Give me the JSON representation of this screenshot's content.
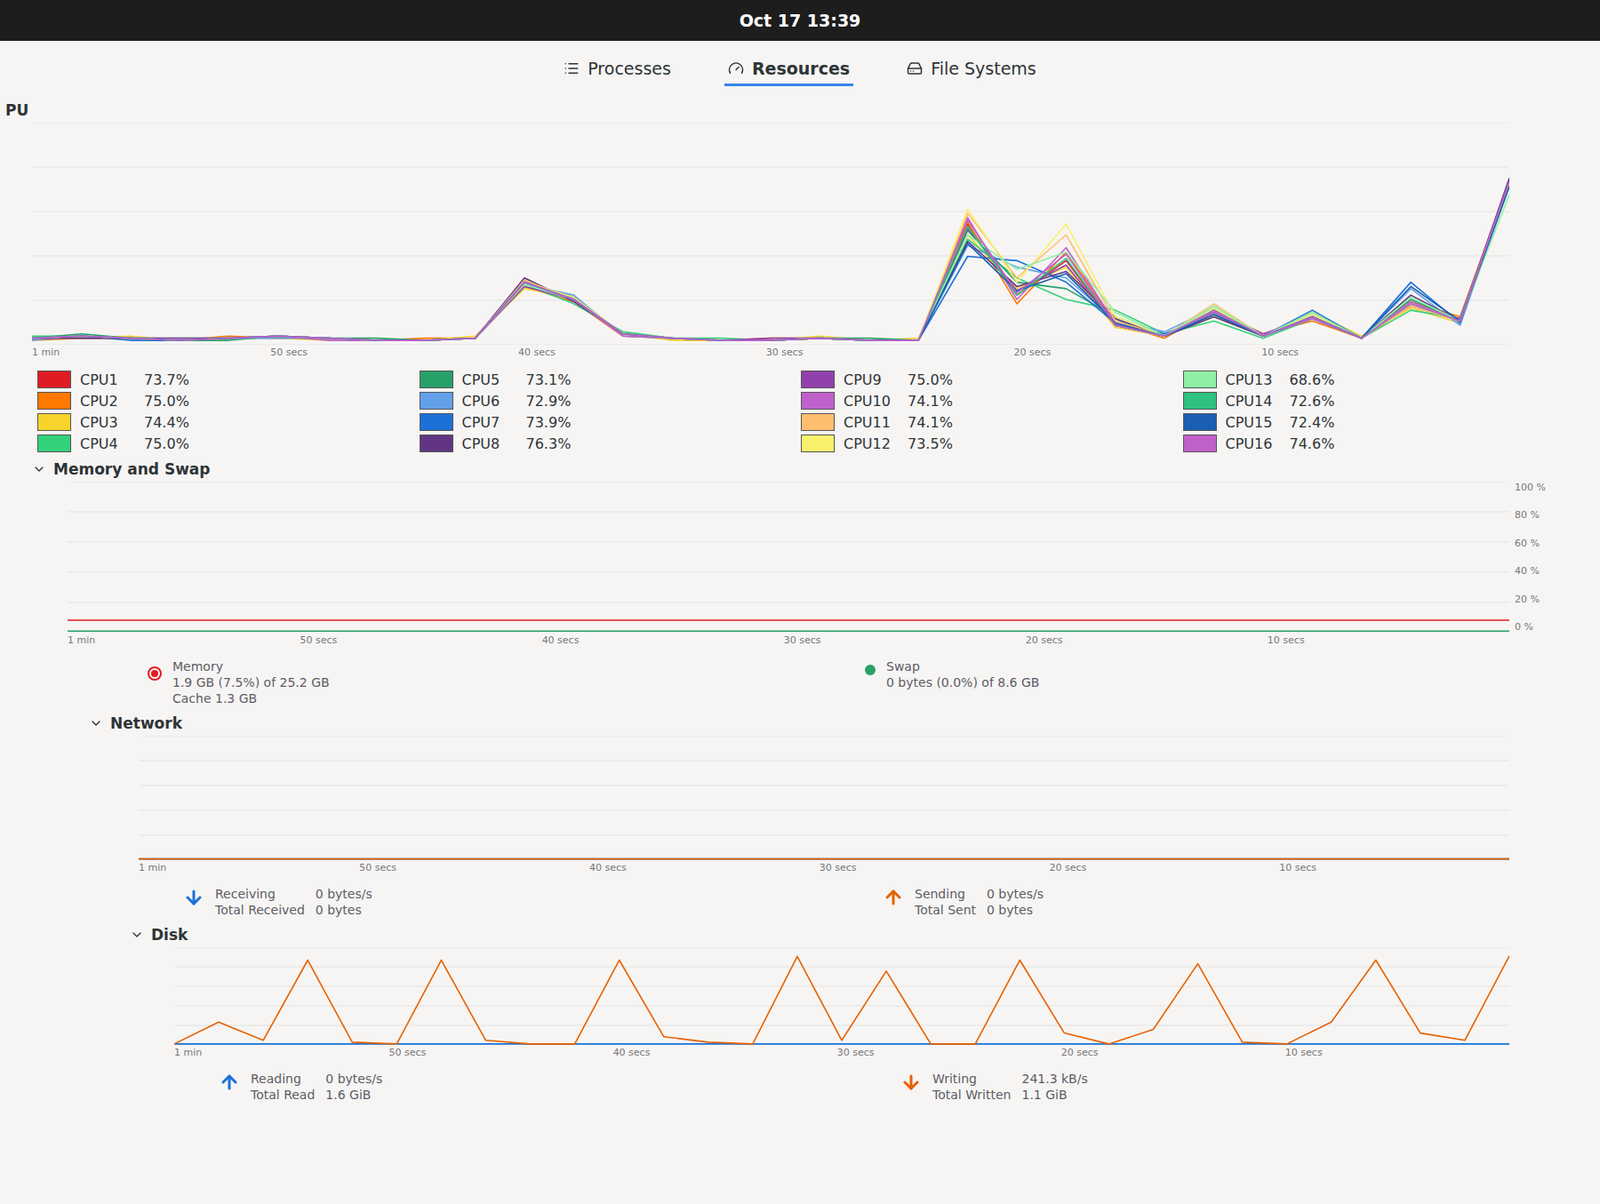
{
  "top_bar": {
    "clock": "Oct 17 13:39"
  },
  "tabs": [
    {
      "label": "Processes",
      "selected": false
    },
    {
      "label": "Resources",
      "selected": true
    },
    {
      "label": "File Systems",
      "selected": false
    }
  ],
  "cpu": {
    "title": "PU",
    "y_max": 100,
    "x_ticks": [
      "1 min",
      "50 secs",
      "40 secs",
      "30 secs",
      "20 secs",
      "10 secs"
    ],
    "series": [
      {
        "name": "CPU1",
        "reading": "73.7%",
        "color": "#e01b24",
        "values": [
          2,
          3,
          2,
          1,
          2,
          3,
          2,
          1,
          1,
          2,
          28,
          20,
          4,
          2,
          1,
          1,
          2,
          1,
          1,
          55,
          22,
          38,
          8,
          3,
          14,
          3,
          12,
          2,
          17,
          10,
          73.7
        ]
      },
      {
        "name": "CPU2",
        "reading": "75.0%",
        "color": "#ff7800",
        "values": [
          1,
          2,
          2,
          1,
          3,
          2,
          2,
          1,
          2,
          2,
          26,
          19,
          3,
          2,
          1,
          2,
          2,
          1,
          1,
          56,
          18,
          42,
          9,
          2,
          15,
          4,
          10,
          2,
          19,
          12,
          75.0
        ]
      },
      {
        "name": "CPU3",
        "reading": "74.4%",
        "color": "#f6d32d",
        "values": [
          2,
          2,
          3,
          1,
          2,
          2,
          1,
          1,
          1,
          3,
          25,
          21,
          4,
          1,
          1,
          1,
          3,
          1,
          2,
          50,
          25,
          35,
          7,
          3,
          12,
          3,
          14,
          3,
          16,
          9,
          74.4
        ]
      },
      {
        "name": "CPU4",
        "reading": "75.0%",
        "color": "#33d17a",
        "values": [
          3,
          3,
          2,
          2,
          2,
          3,
          2,
          1,
          1,
          2,
          27,
          18,
          5,
          2,
          2,
          1,
          2,
          1,
          1,
          48,
          30,
          20,
          15,
          4,
          10,
          2,
          11,
          2,
          15,
          11,
          75.0
        ]
      },
      {
        "name": "CPU5",
        "reading": "73.1%",
        "color": "#26a269",
        "values": [
          2,
          4,
          2,
          1,
          1,
          3,
          2,
          2,
          1,
          2,
          29,
          20,
          4,
          2,
          1,
          1,
          2,
          2,
          1,
          52,
          28,
          25,
          12,
          3,
          13,
          3,
          12,
          2,
          20,
          10,
          73.1
        ]
      },
      {
        "name": "CPU6",
        "reading": "72.9%",
        "color": "#62a0ea",
        "values": [
          1,
          3,
          2,
          1,
          2,
          2,
          2,
          1,
          1,
          2,
          27,
          22,
          3,
          2,
          1,
          1,
          2,
          1,
          1,
          45,
          35,
          30,
          10,
          5,
          16,
          3,
          13,
          2,
          25,
          8,
          72.9
        ]
      },
      {
        "name": "CPU7",
        "reading": "73.9%",
        "color": "#1c71d8",
        "values": [
          2,
          3,
          1,
          1,
          2,
          3,
          2,
          1,
          1,
          2,
          28,
          21,
          4,
          2,
          1,
          1,
          2,
          1,
          1,
          40,
          38,
          28,
          9,
          4,
          14,
          3,
          15,
          2,
          28,
          9,
          73.9
        ]
      },
      {
        "name": "CPU8",
        "reading": "76.3%",
        "color": "#613583",
        "values": [
          2,
          2,
          2,
          1,
          2,
          3,
          2,
          1,
          1,
          2,
          30,
          19,
          4,
          2,
          1,
          1,
          2,
          1,
          1,
          47,
          26,
          33,
          11,
          3,
          12,
          3,
          12,
          2,
          22,
          10,
          76.3
        ]
      },
      {
        "name": "CPU9",
        "reading": "75.0%",
        "color": "#9141ac",
        "values": [
          2,
          3,
          2,
          2,
          2,
          3,
          2,
          1,
          1,
          2,
          26,
          20,
          4,
          2,
          1,
          2,
          2,
          1,
          1,
          53,
          24,
          36,
          8,
          3,
          15,
          4,
          12,
          2,
          18,
          11,
          75.0
        ]
      },
      {
        "name": "CPU10",
        "reading": "74.1%",
        "color": "#c061cb",
        "values": [
          2,
          3,
          2,
          1,
          2,
          3,
          1,
          1,
          1,
          2,
          28,
          20,
          3,
          2,
          1,
          1,
          2,
          1,
          1,
          58,
          20,
          44,
          9,
          3,
          14,
          3,
          11,
          2,
          19,
          10,
          74.1
        ]
      },
      {
        "name": "CPU11",
        "reading": "74.1%",
        "color": "#ffbe6f",
        "values": [
          2,
          3,
          2,
          1,
          2,
          3,
          2,
          1,
          1,
          2,
          29,
          20,
          4,
          2,
          1,
          1,
          2,
          1,
          1,
          60,
          30,
          50,
          10,
          3,
          18,
          3,
          12,
          2,
          17,
          10,
          74.1
        ]
      },
      {
        "name": "CPU12",
        "reading": "73.5%",
        "color": "#f9f06b",
        "values": [
          2,
          3,
          2,
          1,
          2,
          3,
          2,
          1,
          1,
          2,
          28,
          21,
          4,
          2,
          1,
          1,
          2,
          1,
          1,
          62,
          28,
          55,
          12,
          3,
          16,
          3,
          13,
          2,
          18,
          10,
          73.5
        ]
      },
      {
        "name": "CPU13",
        "reading": "68.6%",
        "color": "#8ff0a4",
        "values": [
          2,
          3,
          2,
          1,
          2,
          3,
          2,
          1,
          1,
          2,
          27,
          20,
          4,
          2,
          1,
          1,
          2,
          1,
          1,
          50,
          34,
          42,
          14,
          3,
          17,
          3,
          14,
          2,
          21,
          10,
          68.6
        ]
      },
      {
        "name": "CPU14",
        "reading": "72.6%",
        "color": "#2ec27e",
        "values": [
          2,
          3,
          2,
          1,
          2,
          3,
          2,
          1,
          1,
          2,
          28,
          20,
          4,
          2,
          1,
          1,
          2,
          1,
          1,
          54,
          22,
          39,
          8,
          3,
          15,
          3,
          12,
          2,
          18,
          10,
          72.6
        ]
      },
      {
        "name": "CPU15",
        "reading": "72.4%",
        "color": "#1a5fb4",
        "values": [
          2,
          3,
          2,
          1,
          2,
          3,
          2,
          1,
          1,
          2,
          28,
          20,
          4,
          2,
          1,
          1,
          2,
          1,
          1,
          46,
          24,
          32,
          9,
          3,
          13,
          3,
          12,
          2,
          26,
          10,
          72.4
        ]
      },
      {
        "name": "CPU16",
        "reading": "74.6%",
        "color": "#c061cb",
        "values": [
          2,
          3,
          2,
          1,
          2,
          3,
          2,
          1,
          1,
          2,
          28,
          20,
          4,
          2,
          1,
          1,
          2,
          1,
          1,
          57,
          23,
          41,
          8,
          3,
          15,
          3,
          12,
          2,
          18,
          10,
          74.6
        ]
      }
    ]
  },
  "memory": {
    "title": "Memory and Swap",
    "expanded": true,
    "y_max": 100,
    "y_ticks": [
      "100 %",
      "80 %",
      "60 %",
      "40 %",
      "20 %",
      "0 %"
    ],
    "x_ticks": [
      "1 min",
      "50 secs",
      "40 secs",
      "30 secs",
      "20 secs",
      "10 secs"
    ],
    "memory": {
      "name": "Memory",
      "detail": "1.9 GB (7.5%) of 25.2 GB",
      "cache": "Cache 1.3 GB",
      "color": "#e01b24",
      "values": [
        7.5,
        7.5,
        7.5,
        7.5,
        7.5,
        7.5,
        7.5,
        7.5,
        7.5,
        7.5,
        7.5,
        7.5,
        7.5,
        7.5,
        7.5,
        7.5,
        7.5,
        7.5,
        7.5,
        7.5,
        7.5,
        7.5,
        7.5,
        7.5,
        7.5,
        7.5,
        7.5,
        7.5,
        7.5,
        7.5,
        7.5
      ]
    },
    "swap": {
      "name": "Swap",
      "detail": "0 bytes (0.0%) of 8.6 GB",
      "color": "#26a269",
      "values": [
        0,
        0,
        0,
        0,
        0,
        0,
        0,
        0,
        0,
        0,
        0,
        0,
        0,
        0,
        0,
        0,
        0,
        0,
        0,
        0,
        0,
        0,
        0,
        0,
        0,
        0,
        0,
        0,
        0,
        0,
        0
      ]
    }
  },
  "network": {
    "title": "Network",
    "expanded": true,
    "y_max": 1,
    "x_ticks": [
      "1 min",
      "50 secs",
      "40 secs",
      "30 secs",
      "20 secs",
      "10 secs"
    ],
    "receiving": {
      "label": "Receiving",
      "total_label": "Total Received",
      "rate": "0 bytes/s",
      "total": "0 bytes",
      "color": "#1c71d8",
      "values": [
        0,
        0,
        0,
        0,
        0,
        0,
        0,
        0,
        0,
        0,
        0,
        0,
        0,
        0,
        0,
        0,
        0,
        0,
        0,
        0,
        0,
        0,
        0,
        0,
        0,
        0,
        0,
        0,
        0,
        0,
        0
      ]
    },
    "sending": {
      "label": "Sending",
      "total_label": "Total Sent",
      "rate": "0 bytes/s",
      "total": "0 bytes",
      "color": "#e66100",
      "values": [
        0,
        0,
        0,
        0,
        0,
        0,
        0,
        0,
        0,
        0,
        0,
        0,
        0,
        0,
        0,
        0,
        0,
        0,
        0,
        0,
        0,
        0,
        0,
        0,
        0,
        0,
        0,
        0,
        0,
        0,
        0
      ]
    }
  },
  "disk": {
    "title": "Disk",
    "expanded": true,
    "y_max": 260,
    "x_ticks": [
      "1 min",
      "50 secs",
      "40 secs",
      "30 secs",
      "20 secs",
      "10 secs"
    ],
    "reading": {
      "label": "Reading",
      "total_label": "Total Read",
      "rate": "0 bytes/s",
      "total": "1.6 GiB",
      "color": "#1c71d8",
      "values": [
        0,
        0,
        0,
        0,
        0,
        0,
        0,
        0,
        0,
        0,
        0,
        0,
        0,
        0,
        0,
        0,
        0,
        0,
        0,
        0,
        0,
        0,
        0,
        0,
        0,
        0,
        0,
        0,
        0,
        0,
        0
      ]
    },
    "writing": {
      "label": "Writing",
      "total_label": "Total Written",
      "rate": "241.3 kB/s",
      "total": "1.1 GiB",
      "color": "#e66100",
      "values": [
        0,
        60,
        10,
        230,
        5,
        0,
        230,
        10,
        0,
        0,
        230,
        20,
        5,
        0,
        240,
        10,
        200,
        0,
        0,
        230,
        30,
        0,
        40,
        220,
        5,
        0,
        60,
        230,
        30,
        10,
        241.3
      ]
    }
  }
}
